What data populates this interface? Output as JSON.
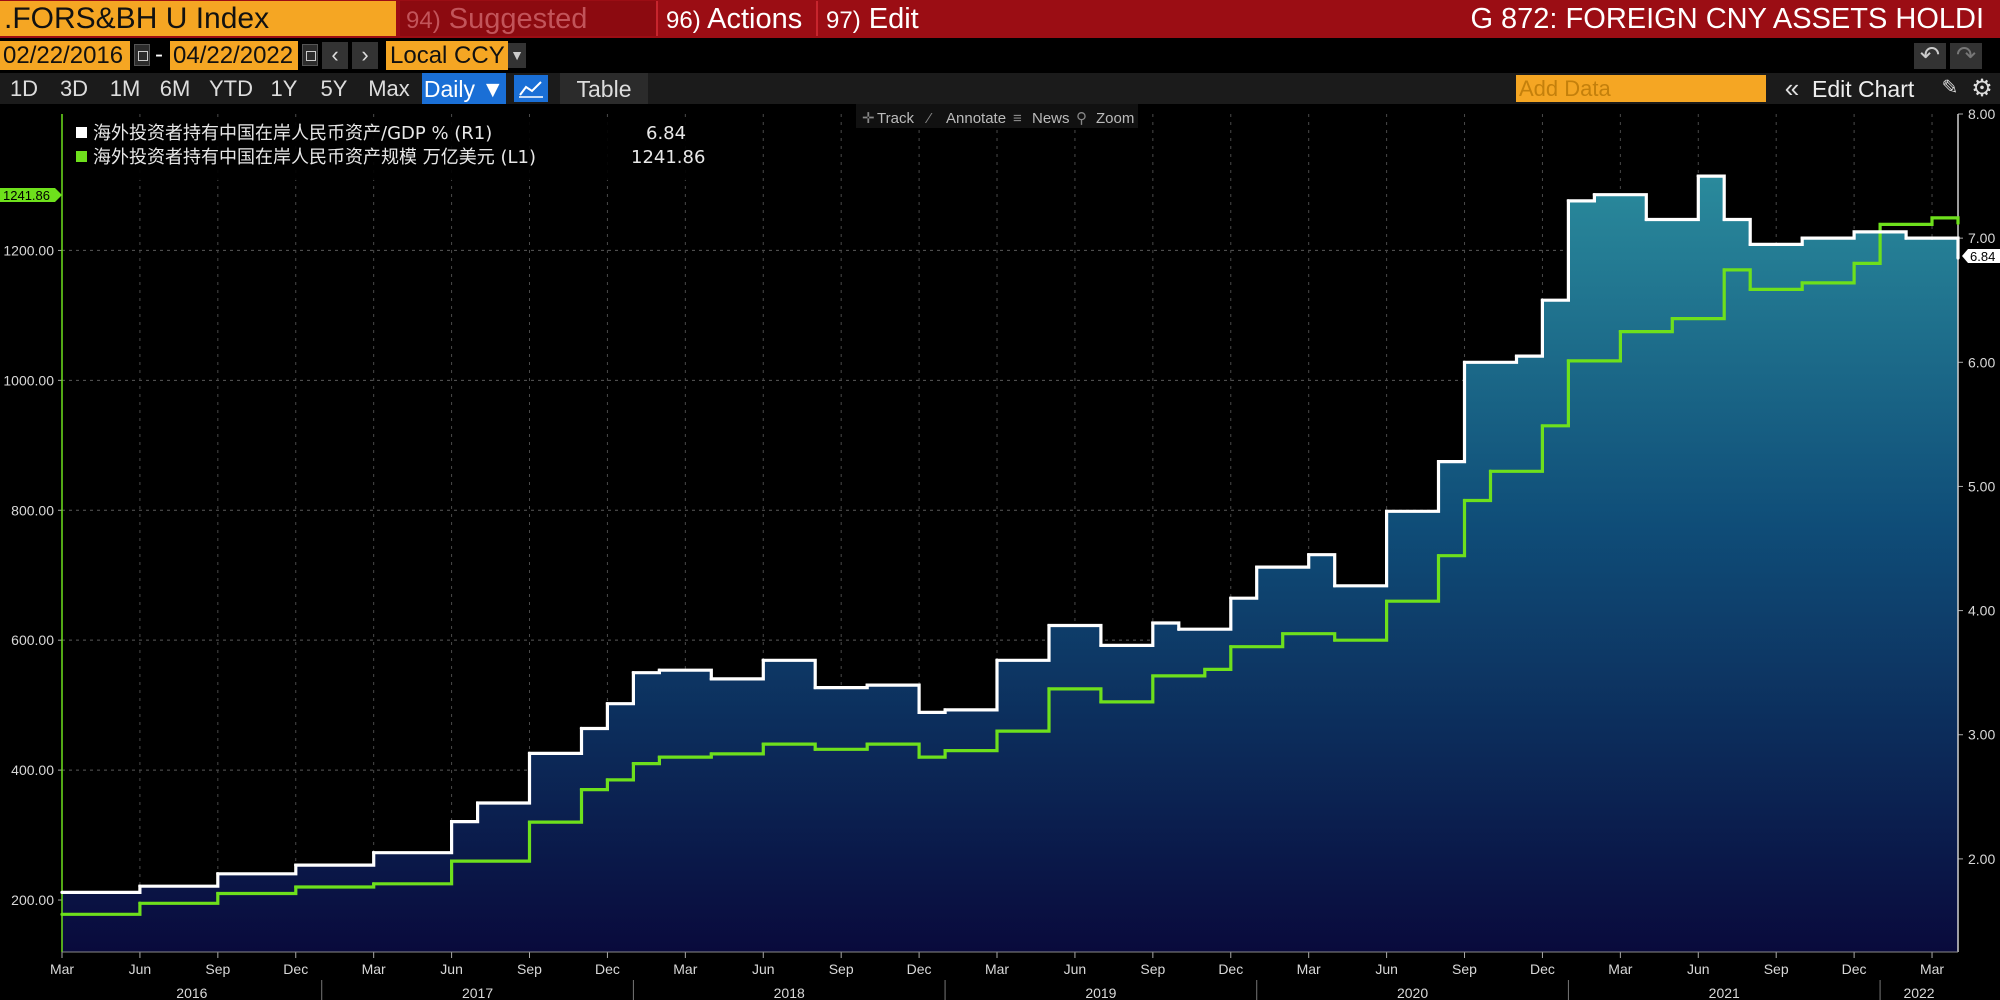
{
  "topbar": {
    "ticker": ".FORS&BH U Index",
    "suggested_num": "94)",
    "suggested_label": "Suggested Charts",
    "actions_num": "96)",
    "actions_label": "Actions",
    "edit_num": "97)",
    "edit_label": "Edit",
    "title": "G 872: FOREIGN CNY ASSETS HOLDI"
  },
  "datebar": {
    "start_date": "02/22/2016",
    "separator": "-",
    "end_date": "04/22/2022",
    "currency": "Local CCY"
  },
  "rangebar": {
    "ranges": [
      "1D",
      "3D",
      "1M",
      "6M",
      "YTD",
      "1Y",
      "5Y",
      "Max"
    ],
    "frequency": "Daily",
    "table_label": "Table",
    "add_data_placeholder": "Add Data",
    "edit_chart_label": "Edit Chart"
  },
  "chart_tools": {
    "track": "Track",
    "annotate": "Annotate",
    "news": "News",
    "zoom": "Zoom"
  },
  "colors": {
    "topbar": "#9b0d14",
    "amber": "#f5a623",
    "series_white": "#ffffff",
    "series_green": "#6ee01c",
    "area_top": "#1d7e92",
    "area_bottom": "#0a0a3a",
    "active_button": "#1a6fd6"
  },
  "chart_data": {
    "type": "line",
    "title": "G 872: FOREIGN CNY ASSETS HOLDI",
    "legend_position": "top-left",
    "grid": true,
    "x_range": [
      "2016-03",
      "2022-04"
    ],
    "left_axis": {
      "range": [
        120,
        1410
      ],
      "ticks": [
        "200.00",
        "400.00",
        "600.00",
        "800.00",
        "1000.00",
        "1200.00"
      ],
      "last_value_label": "1241.86"
    },
    "right_axis": {
      "range": [
        1.25,
        8.0
      ],
      "ticks": [
        "2.00",
        "3.00",
        "4.00",
        "5.00",
        "6.00",
        "7.00",
        "8.00"
      ],
      "last_value_label": "6.84"
    },
    "x_month_ticks": [
      "Mar",
      "Jun",
      "Sep",
      "Dec",
      "Mar",
      "Jun",
      "Sep",
      "Dec",
      "Mar",
      "Jun",
      "Sep",
      "Dec",
      "Mar",
      "Jun",
      "Sep",
      "Dec",
      "Mar",
      "Jun",
      "Sep",
      "Dec",
      "Mar",
      "Jun",
      "Sep",
      "Dec",
      "Mar"
    ],
    "x_year_ticks": [
      "2016",
      "2017",
      "2018",
      "2019",
      "2020",
      "2021",
      "2022"
    ],
    "series": [
      {
        "name": "海外投资者持有中国在岸人民币资产/GDP % (R1)",
        "last_value": "6.84",
        "axis": "right",
        "color": "#ffffff",
        "points": [
          [
            "2016-03",
            1.73
          ],
          [
            "2016-06",
            1.78
          ],
          [
            "2016-09",
            1.88
          ],
          [
            "2016-12",
            1.95
          ],
          [
            "2017-03",
            2.05
          ],
          [
            "2017-06",
            2.3
          ],
          [
            "2017-07",
            2.45
          ],
          [
            "2017-09",
            2.85
          ],
          [
            "2017-11",
            3.05
          ],
          [
            "2017-12",
            3.25
          ],
          [
            "2018-01",
            3.5
          ],
          [
            "2018-02",
            3.52
          ],
          [
            "2018-04",
            3.45
          ],
          [
            "2018-06",
            3.6
          ],
          [
            "2018-08",
            3.38
          ],
          [
            "2018-10",
            3.4
          ],
          [
            "2018-12",
            3.18
          ],
          [
            "2019-01",
            3.2
          ],
          [
            "2019-03",
            3.6
          ],
          [
            "2019-05",
            3.88
          ],
          [
            "2019-07",
            3.72
          ],
          [
            "2019-09",
            3.9
          ],
          [
            "2019-10",
            3.85
          ],
          [
            "2019-12",
            4.1
          ],
          [
            "2020-01",
            4.35
          ],
          [
            "2020-03",
            4.45
          ],
          [
            "2020-04",
            4.2
          ],
          [
            "2020-06",
            4.8
          ],
          [
            "2020-08",
            5.2
          ],
          [
            "2020-09",
            6.0
          ],
          [
            "2020-11",
            6.05
          ],
          [
            "2020-12",
            6.5
          ],
          [
            "2021-01",
            7.3
          ],
          [
            "2021-02",
            7.35
          ],
          [
            "2021-04",
            7.15
          ],
          [
            "2021-06",
            7.5
          ],
          [
            "2021-07",
            7.15
          ],
          [
            "2021-08",
            6.95
          ],
          [
            "2021-10",
            7.0
          ],
          [
            "2021-12",
            7.05
          ],
          [
            "2022-02",
            7.0
          ],
          [
            "2022-03",
            7.0
          ],
          [
            "2022-04",
            6.84
          ]
        ]
      },
      {
        "name": "海外投资者持有中国在岸人民币资产规模 万亿美元 (L1)",
        "last_value": "1241.86",
        "axis": "left",
        "color": "#6ee01c",
        "points": [
          [
            "2016-03",
            178
          ],
          [
            "2016-06",
            195
          ],
          [
            "2016-09",
            210
          ],
          [
            "2016-12",
            220
          ],
          [
            "2017-03",
            225
          ],
          [
            "2017-06",
            260
          ],
          [
            "2017-09",
            320
          ],
          [
            "2017-11",
            370
          ],
          [
            "2017-12",
            385
          ],
          [
            "2018-01",
            410
          ],
          [
            "2018-02",
            420
          ],
          [
            "2018-04",
            425
          ],
          [
            "2018-06",
            440
          ],
          [
            "2018-08",
            432
          ],
          [
            "2018-10",
            440
          ],
          [
            "2018-12",
            420
          ],
          [
            "2019-01",
            430
          ],
          [
            "2019-03",
            460
          ],
          [
            "2019-05",
            525
          ],
          [
            "2019-07",
            505
          ],
          [
            "2019-09",
            545
          ],
          [
            "2019-11",
            555
          ],
          [
            "2019-12",
            590
          ],
          [
            "2020-02",
            610
          ],
          [
            "2020-04",
            600
          ],
          [
            "2020-06",
            660
          ],
          [
            "2020-08",
            730
          ],
          [
            "2020-09",
            815
          ],
          [
            "2020-10",
            860
          ],
          [
            "2020-12",
            930
          ],
          [
            "2021-01",
            1030
          ],
          [
            "2021-03",
            1075
          ],
          [
            "2021-05",
            1095
          ],
          [
            "2021-07",
            1170
          ],
          [
            "2021-08",
            1140
          ],
          [
            "2021-10",
            1150
          ],
          [
            "2021-12",
            1180
          ],
          [
            "2022-01",
            1240
          ],
          [
            "2022-03",
            1250
          ],
          [
            "2022-04",
            1241.86
          ]
        ]
      }
    ]
  }
}
